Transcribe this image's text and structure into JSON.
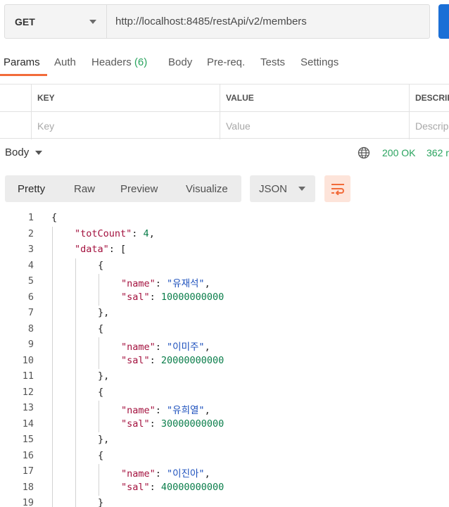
{
  "request": {
    "method": "GET",
    "url": "http://localhost:8485/restApi/v2/members"
  },
  "tabs": [
    {
      "label": "Params"
    },
    {
      "label": "Auth"
    },
    {
      "label": "Headers",
      "count": "(6)"
    },
    {
      "label": "Body"
    },
    {
      "label": "Pre-req."
    },
    {
      "label": "Tests"
    },
    {
      "label": "Settings"
    }
  ],
  "params_table": {
    "headers": [
      "KEY",
      "VALUE",
      "DESCRIP"
    ],
    "placeholders": [
      "Key",
      "Value",
      "Descrip"
    ]
  },
  "response": {
    "body_label": "Body",
    "status": "200 OK",
    "time": "362 r"
  },
  "view_modes": [
    "Pretty",
    "Raw",
    "Preview",
    "Visualize"
  ],
  "format": "JSON",
  "code_lines": [
    {
      "n": "1",
      "indent": 0,
      "tokens": [
        [
          "p",
          "{"
        ]
      ]
    },
    {
      "n": "2",
      "indent": 1,
      "tokens": [
        [
          "k",
          "\"totCount\""
        ],
        [
          "p",
          ": "
        ],
        [
          "n",
          "4"
        ],
        [
          "p",
          ","
        ]
      ]
    },
    {
      "n": "3",
      "indent": 1,
      "tokens": [
        [
          "k",
          "\"data\""
        ],
        [
          "p",
          ": ["
        ]
      ]
    },
    {
      "n": "4",
      "indent": 2,
      "tokens": [
        [
          "p",
          "{"
        ]
      ]
    },
    {
      "n": "5",
      "indent": 3,
      "tokens": [
        [
          "k",
          "\"name\""
        ],
        [
          "p",
          ": "
        ],
        [
          "s",
          "\"유재석\""
        ],
        [
          "p",
          ","
        ]
      ]
    },
    {
      "n": "6",
      "indent": 3,
      "tokens": [
        [
          "k",
          "\"sal\""
        ],
        [
          "p",
          ": "
        ],
        [
          "n",
          "10000000000"
        ]
      ]
    },
    {
      "n": "7",
      "indent": 2,
      "tokens": [
        [
          "p",
          "},"
        ]
      ]
    },
    {
      "n": "8",
      "indent": 2,
      "tokens": [
        [
          "p",
          "{"
        ]
      ]
    },
    {
      "n": "9",
      "indent": 3,
      "tokens": [
        [
          "k",
          "\"name\""
        ],
        [
          "p",
          ": "
        ],
        [
          "s",
          "\"이미주\""
        ],
        [
          "p",
          ","
        ]
      ]
    },
    {
      "n": "10",
      "indent": 3,
      "tokens": [
        [
          "k",
          "\"sal\""
        ],
        [
          "p",
          ": "
        ],
        [
          "n",
          "20000000000"
        ]
      ]
    },
    {
      "n": "11",
      "indent": 2,
      "tokens": [
        [
          "p",
          "},"
        ]
      ]
    },
    {
      "n": "12",
      "indent": 2,
      "tokens": [
        [
          "p",
          "{"
        ]
      ]
    },
    {
      "n": "13",
      "indent": 3,
      "tokens": [
        [
          "k",
          "\"name\""
        ],
        [
          "p",
          ": "
        ],
        [
          "s",
          "\"유희열\""
        ],
        [
          "p",
          ","
        ]
      ]
    },
    {
      "n": "14",
      "indent": 3,
      "tokens": [
        [
          "k",
          "\"sal\""
        ],
        [
          "p",
          ": "
        ],
        [
          "n",
          "30000000000"
        ]
      ]
    },
    {
      "n": "15",
      "indent": 2,
      "tokens": [
        [
          "p",
          "},"
        ]
      ]
    },
    {
      "n": "16",
      "indent": 2,
      "tokens": [
        [
          "p",
          "{"
        ]
      ]
    },
    {
      "n": "17",
      "indent": 3,
      "tokens": [
        [
          "k",
          "\"name\""
        ],
        [
          "p",
          ": "
        ],
        [
          "s",
          "\"이진아\""
        ],
        [
          "p",
          ","
        ]
      ]
    },
    {
      "n": "18",
      "indent": 3,
      "tokens": [
        [
          "k",
          "\"sal\""
        ],
        [
          "p",
          ": "
        ],
        [
          "n",
          "40000000000"
        ]
      ]
    },
    {
      "n": "19",
      "indent": 2,
      "tokens": [
        [
          "p",
          "}"
        ]
      ]
    }
  ],
  "colors": {
    "accent": "#f26b3a",
    "success": "#29a35e",
    "key": "#a3113e",
    "string": "#1b4fbc",
    "number": "#0b7e4b",
    "send": "#1b6fd6"
  },
  "icons": {
    "method_dropdown": "chevron-down-icon",
    "body_dropdown": "caret-down-icon",
    "network": "globe-icon",
    "format_dropdown": "chevron-down-icon",
    "wrap": "wrap-lines-icon"
  }
}
